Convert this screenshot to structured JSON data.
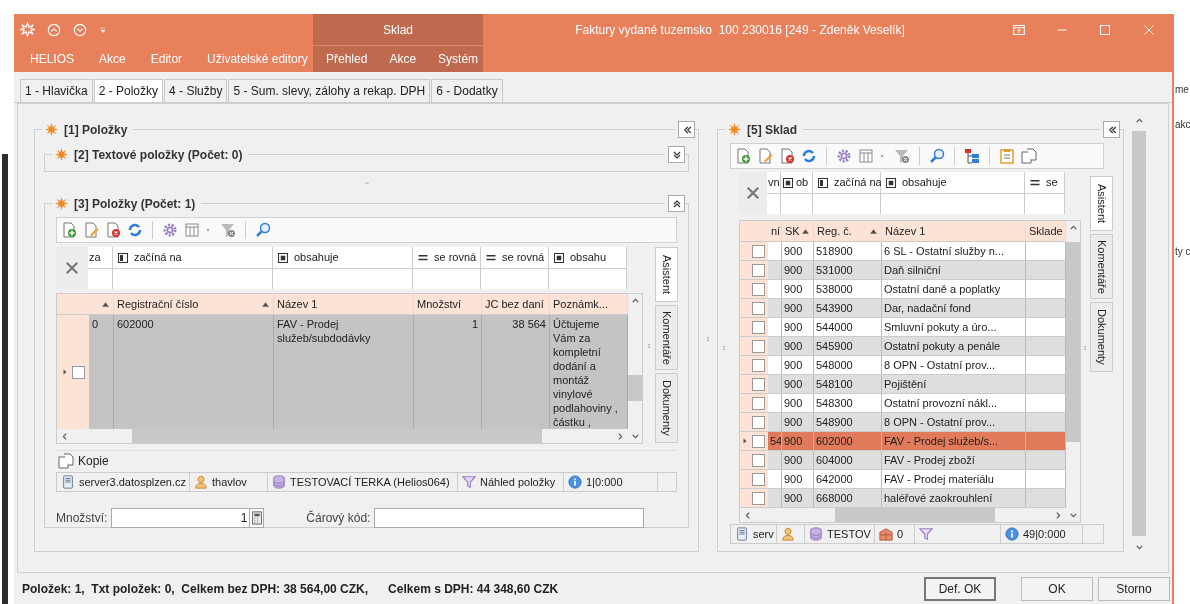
{
  "ribbon": {
    "menu": [
      "HELIOS",
      "Akce",
      "Editor",
      "Uživatelské editory"
    ],
    "context_group": {
      "title": "Sklad",
      "menu": [
        "Přehled",
        "Akce",
        "Systém"
      ]
    }
  },
  "window": {
    "title": "Faktury vydané tuzemsko  100 230016 [249 - Zdeněk Veselík]"
  },
  "tabs": [
    {
      "label": "1 - Hlavička",
      "selected": false
    },
    {
      "label": "2 - Položky",
      "selected": true
    },
    {
      "label": "4 - Služby",
      "selected": false
    },
    {
      "label": "5 - Sum. slevy, zálohy a rekap. DPH",
      "selected": false
    },
    {
      "label": "6 - Dodatky",
      "selected": false
    }
  ],
  "items_panel": {
    "title": "[1] Položky",
    "text_items": {
      "title": "[2] Textové položky (Počet: 0)",
      "expanded": false
    },
    "items": {
      "title": "[3] Položky (Počet: 1)",
      "expanded": true,
      "filters": [
        {
          "label": "za"
        },
        {
          "kind": "starts",
          "label": "začíná na"
        },
        {
          "kind": "contains",
          "label": "obsahuje"
        },
        {
          "kind": "equals",
          "label": "se rovná"
        },
        {
          "kind": "equals",
          "label": "se rovná"
        },
        {
          "kind": "contains",
          "label": "obsahu"
        }
      ],
      "columns": [
        {
          "sorted": true
        },
        {
          "label": "Registrační číslo",
          "sorted": true
        },
        {
          "label": "Název 1",
          "sorted": false
        },
        {
          "label": "Množství",
          "sorted": false
        },
        {
          "label": "JC bez daní",
          "sorted": false
        },
        {
          "label": "Poznámk...",
          "sorted": false
        }
      ],
      "rows": [
        {
          "column_1": "0",
          "reg": "602000",
          "name": "FAV - Prodej služeb/subdodávky",
          "quantity": "1",
          "price": "38 564",
          "note": "Účtujeme Vám za kompletní dodání a montáž vinylové podlahoviny , částku ,",
          "selected": true,
          "checked": false
        }
      ],
      "side_tabs": [
        {
          "label": "Asistent",
          "selected": true
        },
        {
          "label": "Komentáře",
          "selected": false
        },
        {
          "label": "Dokumenty",
          "selected": false
        }
      ],
      "copy_button": "Kopie",
      "status_bar": [
        {
          "kind": "server",
          "text": "server3.datosplzen.cz"
        },
        {
          "kind": "user",
          "text": "thavlov"
        },
        {
          "kind": "database",
          "text": "TESTOVACÍ TERKA (Helios064)"
        },
        {
          "kind": "filter",
          "text": "Náhled položky"
        },
        {
          "kind": "info",
          "text": "1|0:000"
        }
      ],
      "quantity": {
        "label": "Množství:",
        "value": "1"
      },
      "barcode": {
        "label": "Čárový kód:"
      }
    }
  },
  "warehouse_panel": {
    "title": "[5] Sklad",
    "filters": [
      {
        "label": "vn"
      },
      {
        "kind": "contains",
        "label": "ob"
      },
      {
        "kind": "starts",
        "label": "začíná na"
      },
      {
        "kind": "contains",
        "label": "obsahuje"
      },
      {
        "kind": "equals",
        "label": "se"
      }
    ],
    "columns": [
      {
        "label": "ní"
      },
      {
        "label": "SK",
        "sorted": true
      },
      {
        "label": "Reg. č.",
        "sorted": true
      },
      {
        "label": "Název 1",
        "sorted": false
      },
      {
        "label": "Sklade"
      }
    ],
    "rows": [
      {
        "sk": "900",
        "reg": "518900",
        "name": "6 SL - Ostatní služby n...",
        "selected": false,
        "checked": false
      },
      {
        "sk": "900",
        "reg": "531000",
        "name": "Daň silniční",
        "selected": false,
        "checked": false
      },
      {
        "sk": "900",
        "reg": "538000",
        "name": "Ostatní daně a poplatky",
        "selected": false,
        "checked": false
      },
      {
        "sk": "900",
        "reg": "543900",
        "name": "Dar, nadační fond",
        "selected": false,
        "checked": false
      },
      {
        "sk": "900",
        "reg": "544000",
        "name": "Smluvní pokuty a úro...",
        "selected": false,
        "checked": false
      },
      {
        "sk": "900",
        "reg": "545900",
        "name": "Ostatní pokuty a penále",
        "selected": false,
        "checked": false
      },
      {
        "sk": "900",
        "reg": "548000",
        "name": "8 OPN - Ostatní prov...",
        "selected": false,
        "checked": false
      },
      {
        "sk": "900",
        "reg": "548100",
        "name": "Pojištění",
        "selected": false,
        "checked": false
      },
      {
        "sk": "900",
        "reg": "548300",
        "name": "Ostatní provozní nákl...",
        "selected": false,
        "checked": false
      },
      {
        "sk": "900",
        "reg": "548900",
        "name": "8 OPN - Ostatní prov...",
        "selected": false,
        "checked": false
      },
      {
        "column_1": "54",
        "sk": "900",
        "reg": "602000",
        "name": "FAV - Prodej služeb/s...",
        "selected": true,
        "checked": false
      },
      {
        "sk": "900",
        "reg": "604000",
        "name": "FAV - Prodej zboží",
        "selected": false,
        "checked": false
      },
      {
        "sk": "900",
        "reg": "642000",
        "name": "FAV - Prodej materiálu",
        "selected": false,
        "checked": false
      },
      {
        "sk": "900",
        "reg": "668000",
        "name": "haléřové zaokrouhlení",
        "selected": false,
        "checked": false
      }
    ],
    "side_tabs": [
      {
        "label": "Asistent",
        "selected": true
      },
      {
        "label": "Komentáře",
        "selected": false
      },
      {
        "label": "Dokumenty",
        "selected": false
      }
    ],
    "status_bar": [
      {
        "kind": "server",
        "text": "serv"
      },
      {
        "kind": "user"
      },
      {
        "kind": "database",
        "text": "TESTOV"
      },
      {
        "kind": "warehouse",
        "text": "0"
      },
      {
        "kind": "filter"
      },
      {
        "kind": "info",
        "text": "49|0:000"
      }
    ]
  },
  "summary": [
    "Položek: 1,  Txt položek: 0,  Celkem bez DPH: 38 564,00 CZK,",
    "Celkem s DPH: 44 348,60 CZK"
  ],
  "buttons": [
    {
      "label": "Def. OK",
      "default": true
    },
    {
      "label": "OK",
      "default": false
    },
    {
      "label": "Storno",
      "default": false
    }
  ],
  "background_window": {
    "texts": [
      "me",
      "akc",
      "ty c"
    ]
  }
}
